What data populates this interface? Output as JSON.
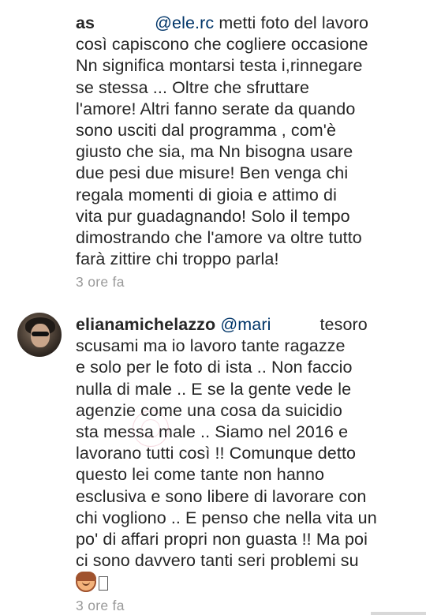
{
  "comments": [
    {
      "username": "as",
      "mention": "@ele.rc",
      "text_lines": [
        "metti foto del lavoro",
        "così capiscono che cogliere occasione",
        "Nn significa montarsi testa i,rinnegare",
        "se stessa ... Oltre che sfruttare",
        "l'amore! Altri fanno serate da quando",
        "sono usciti dal programma , com'è",
        "giusto che sia, ma Nn bisogna usare",
        "due pesi due misure! Ben venga chi",
        "regala momenti di gioia e attimo di",
        "vita pur guadagnando! Solo il tempo",
        "dimostrando che l'amore va oltre tutto",
        "farà zittire chi troppo parla!"
      ],
      "time": "3 ore fa"
    },
    {
      "username": "elianamichelazzo",
      "mention": "@mari",
      "text_lines": [
        "tesoro",
        "scusami ma io lavoro tante ragazze",
        "e solo per le foto di ista .. Non faccio",
        "nulla di male .. E se la gente vede le",
        "agenzie come una cosa da suicidio",
        "sta messa male .. Siamo nel 2016 e",
        "lavorano tutti così !! Comunque detto",
        "questo lei come tante non hanno",
        "esclusiva e sono libere di lavorare con",
        "chi vogliono .. E penso che nella vita un",
        "po' di affari propri non guasta !! Ma poi",
        "ci sono davvero tanti seri problemi su"
      ],
      "emoji_icon": "girl-face-emoji",
      "missing_glyph_icon": "missing-glyph-box",
      "time": "3 ore fa"
    }
  ],
  "colors": {
    "text": "#262626",
    "mention": "#003569",
    "timestamp": "#999999"
  }
}
